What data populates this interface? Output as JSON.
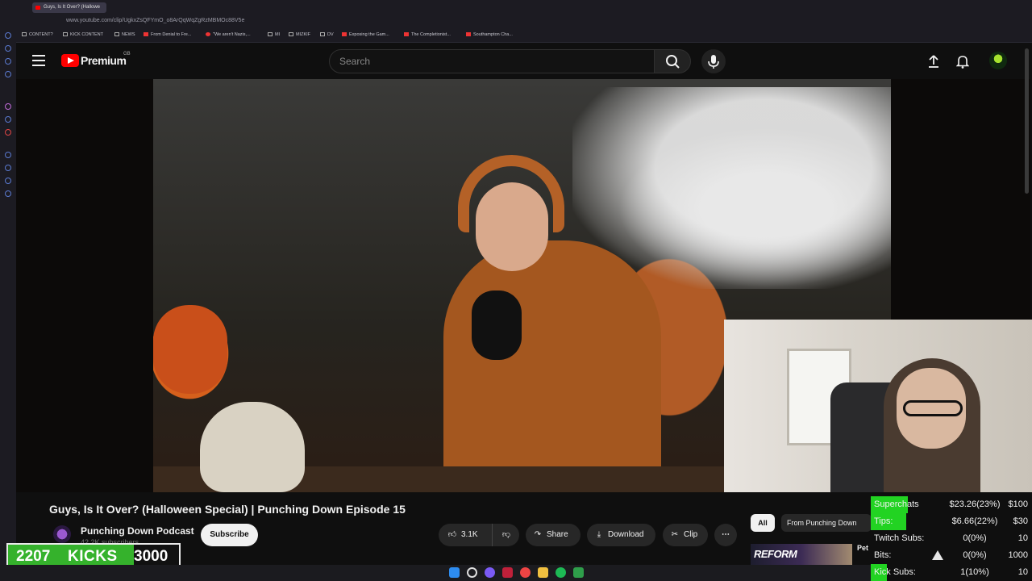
{
  "browser": {
    "tab_title": "Guys, Is It Over? (Hallowe",
    "url": "www.youtube.com/clip/UgkxZsQFYmO_o8ArQqWqZgRzMBMOc88V5e",
    "bookmarks": [
      "CONTENT?",
      "KICK CONTENT",
      "NEWS",
      "From Denial to Fre...",
      "\"We aren't Nazis,...",
      "MI",
      "MIZKIF",
      "DV",
      "Exposing the Gam...",
      "The Completionist...",
      "Southampton Cha..."
    ]
  },
  "header": {
    "logo_text": "Premium",
    "region": "GB",
    "search_placeholder": "Search"
  },
  "video": {
    "title": "Guys, Is It Over? (Halloween Special) | Punching Down Episode 15",
    "channel_name": "Punching Down Podcast",
    "subscriber_count": "42.2K subscribers",
    "subscribe_label": "Subscribe",
    "like_count": "3.1K",
    "share_label": "Share",
    "download_label": "Download",
    "clip_label": "Clip",
    "more_label": "⋯"
  },
  "recommendations": {
    "chip_all": "All",
    "chip_from": "From Punching Down",
    "thumb_text": "REFORM",
    "title_fragment": "Pet"
  },
  "stats": [
    {
      "label": "Superchats",
      "value": "$23.26(23%)",
      "goal": "$100",
      "progress": 0.23
    },
    {
      "label": "Tips:",
      "value": "$6.66(22%)",
      "goal": "$30",
      "progress": 0.22
    },
    {
      "label": "Twitch Subs:",
      "value": "0(0%)",
      "goal": "10",
      "progress": 0
    },
    {
      "label": "Bits:",
      "value": "0(0%)",
      "goal": "1000",
      "progress": 0
    },
    {
      "label": "Kick Subs:",
      "value": "1(10%)",
      "goal": "10",
      "progress": 0.1
    }
  ],
  "kicks": {
    "current": "2207",
    "label": "KICKS",
    "goal": "3000",
    "progress": 0.7357
  },
  "colors": {
    "youtube_red": "#ff0000",
    "stat_green": "#22d322",
    "kicks_green": "#35b22c"
  }
}
